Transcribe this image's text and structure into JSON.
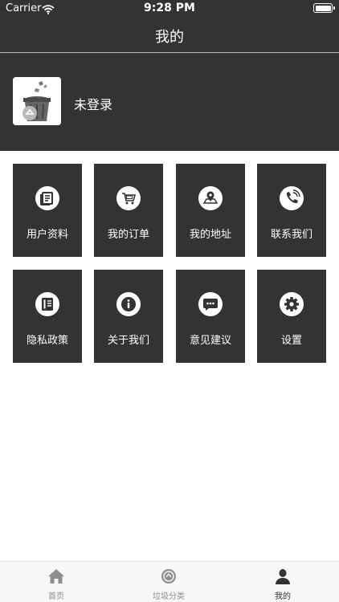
{
  "status": {
    "carrier": "Carrier",
    "time": "9:28 PM"
  },
  "nav": {
    "title": "我的"
  },
  "profile": {
    "login_label": "未登录"
  },
  "menu": [
    {
      "label": "用户资料",
      "icon": "profile-doc-icon"
    },
    {
      "label": "我的订单",
      "icon": "cart-icon"
    },
    {
      "label": "我的地址",
      "icon": "map-pin-icon"
    },
    {
      "label": "联系我们",
      "icon": "phone-icon"
    },
    {
      "label": "隐私政策",
      "icon": "clipboard-icon"
    },
    {
      "label": "关于我们",
      "icon": "info-icon"
    },
    {
      "label": "意见建议",
      "icon": "chat-bubble-icon"
    },
    {
      "label": "设置",
      "icon": "gear-icon"
    }
  ],
  "tabs": [
    {
      "label": "首页",
      "icon": "home-icon"
    },
    {
      "label": "垃圾分类",
      "icon": "recycle-icon"
    },
    {
      "label": "我的",
      "icon": "user-icon"
    }
  ],
  "colors": {
    "dark": "#333333",
    "tab_inactive": "#8e8e8e",
    "tab_bg": "#f7f7f7"
  }
}
